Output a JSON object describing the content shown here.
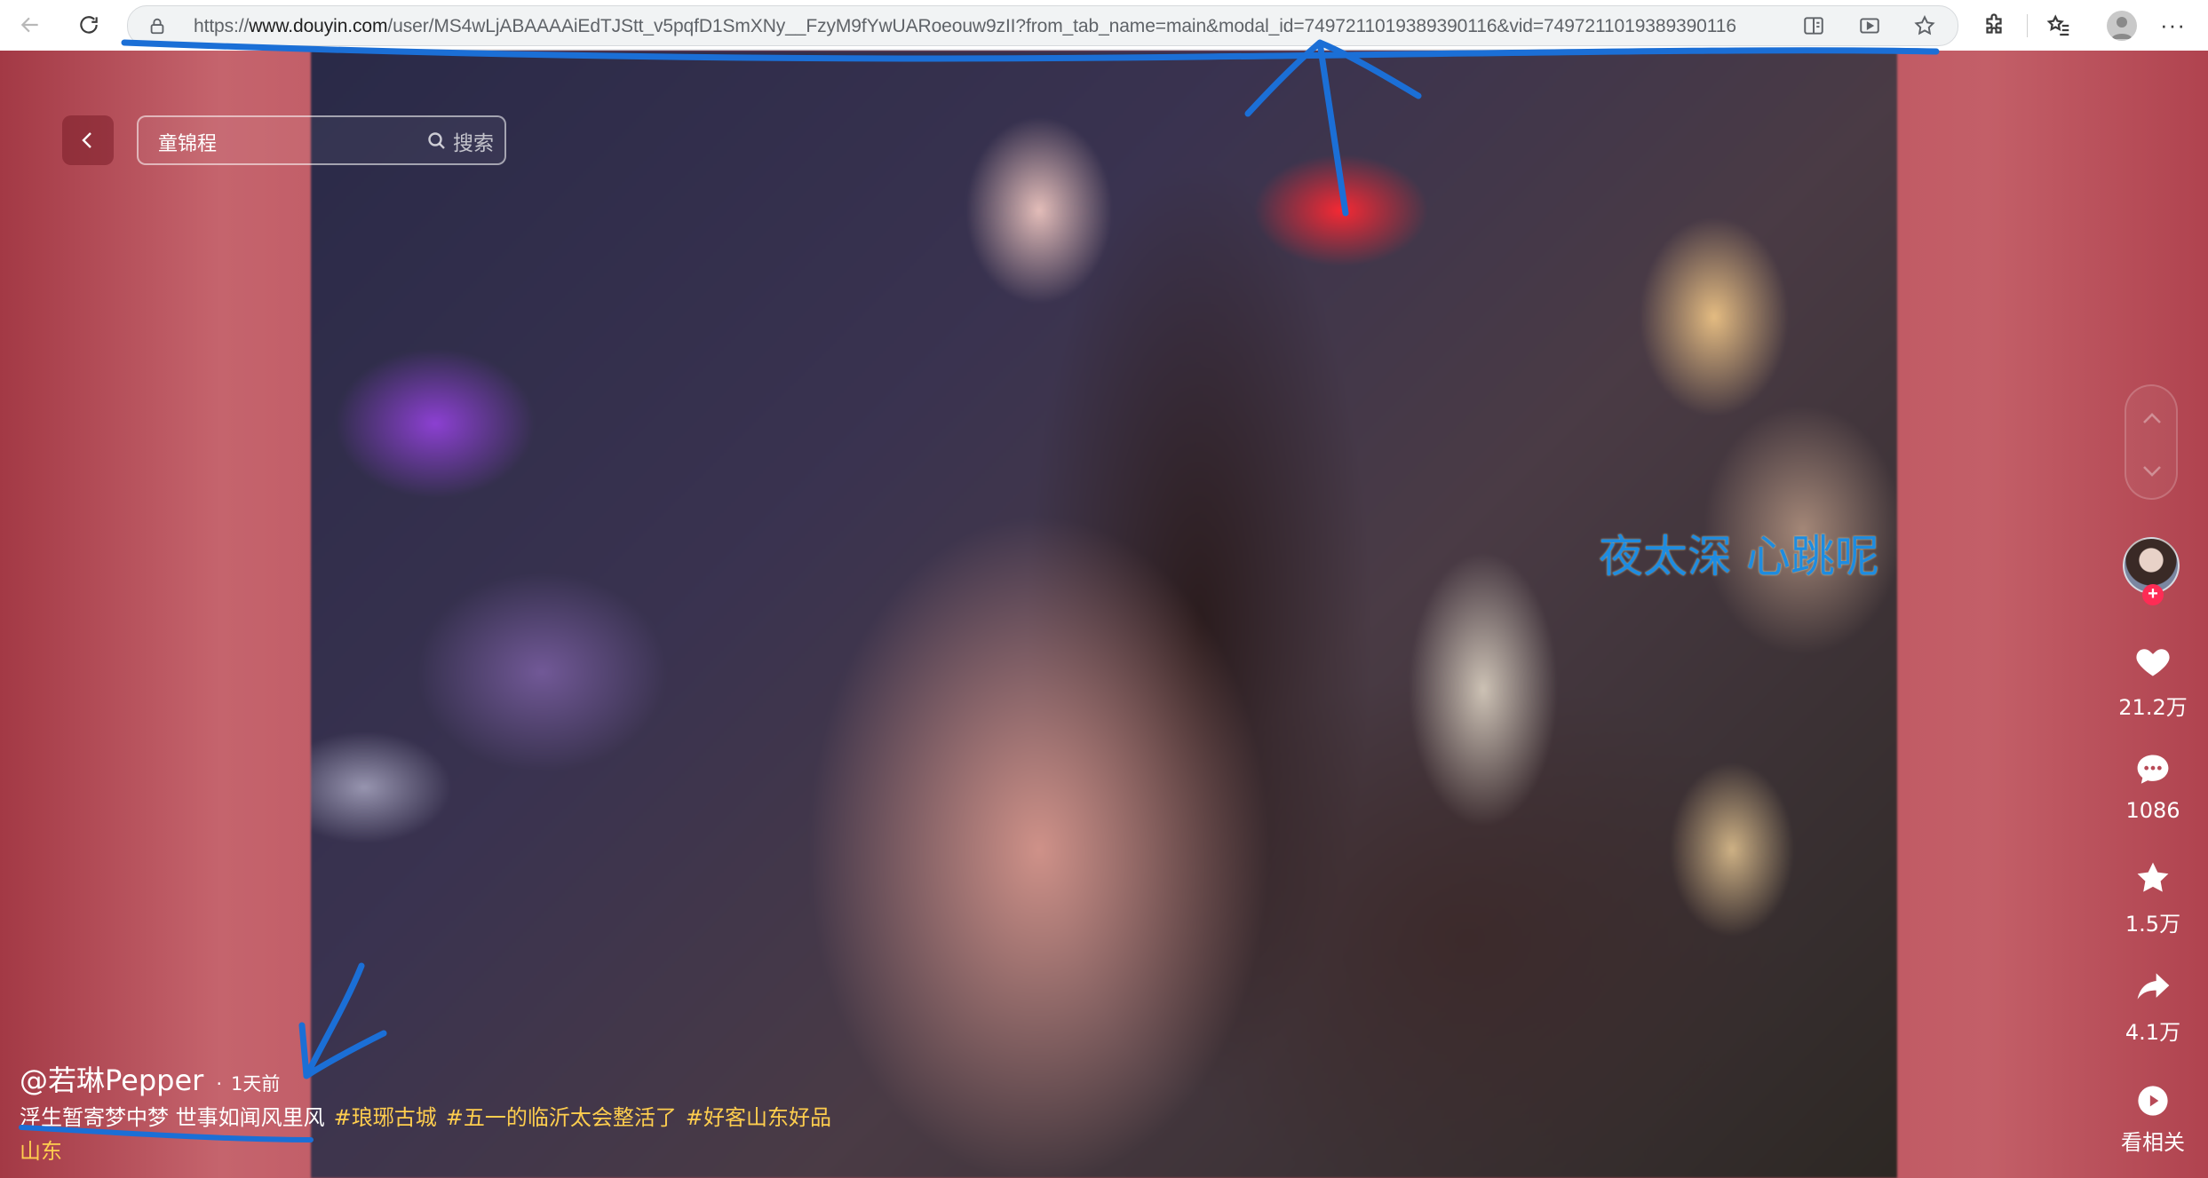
{
  "browser": {
    "url_prefix": "https://",
    "url_host": "www.douyin.com",
    "url_rest": "/user/MS4wLjABAAAAiEdTJStt_v5pqfD1SmXNy__FzyM9fYwUARoeouw9zII?from_tab_name=main&modal_id=7497211019389390116&vid=7497211019389390116"
  },
  "search": {
    "value": "童锦程",
    "button_label": "搜索"
  },
  "video": {
    "overlay_caption": "夜太深 心跳呢"
  },
  "author": {
    "name": "@若琳Pepper",
    "time": "1天前"
  },
  "description": {
    "text": "浮生暂寄梦中梦 世事如闻风里风",
    "hashtags": [
      "#琅琊古城",
      "#五一的临沂太会整活了",
      "#好客山东好品山东"
    ]
  },
  "rail": {
    "likes": "21.2万",
    "comments": "1086",
    "favorites": "1.5万",
    "shares": "4.1万",
    "related": "看相关"
  },
  "colors": {
    "page_bg": "#b84a57",
    "hashtag": "#ffce4e",
    "annotation": "#1b6fd6",
    "follow_badge": "#fe2c55",
    "overlay_caption": "#1e8ce0"
  },
  "icons": [
    "back-arrow-icon",
    "forward-arrow-icon",
    "reload-icon",
    "lock-icon",
    "split-screen-icon",
    "read-aloud-icon",
    "favorite-star-icon",
    "extensions-icon",
    "favorites-list-icon",
    "search-icon",
    "chevron-up-icon",
    "chevron-down-icon",
    "heart-icon",
    "comment-icon",
    "star-icon",
    "share-icon",
    "play-icon"
  ]
}
